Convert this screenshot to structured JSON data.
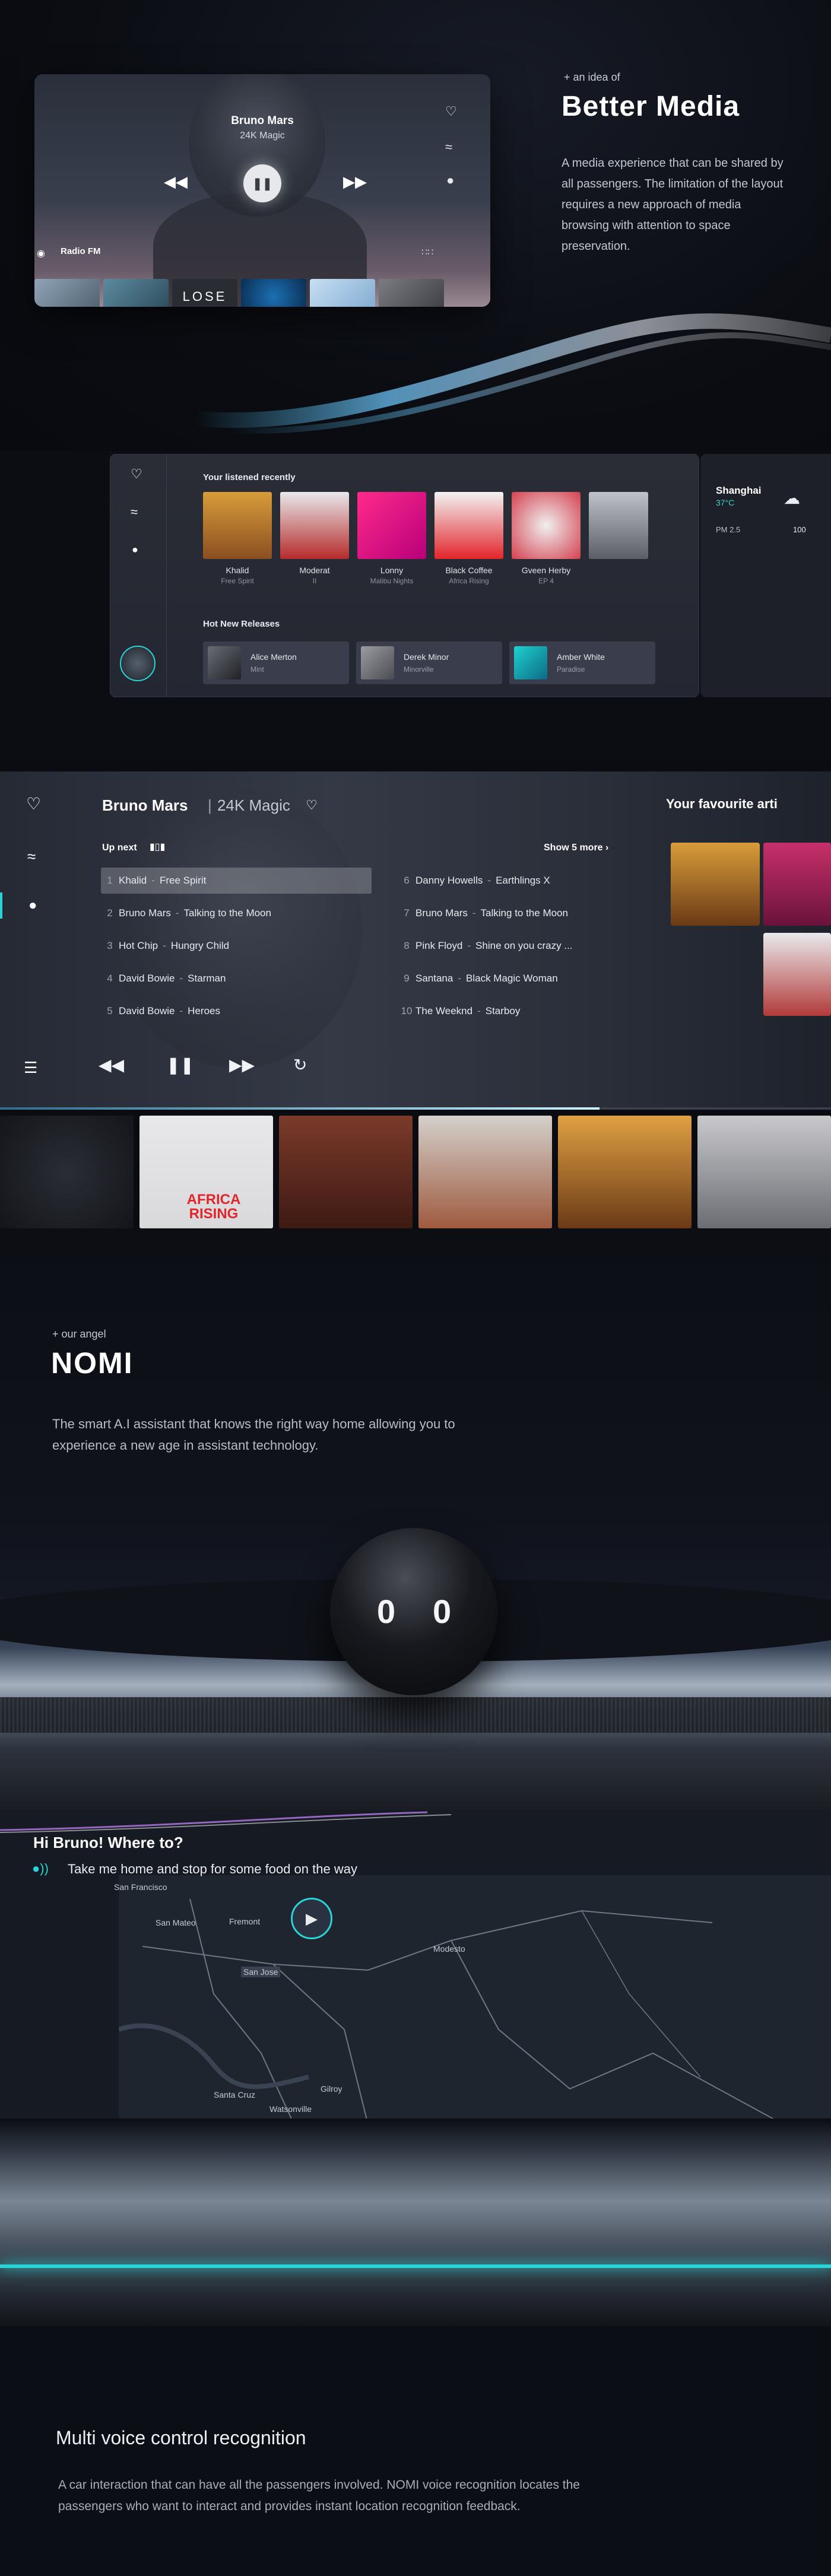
{
  "media": {
    "player": {
      "artist": "Bruno Mars",
      "album": "24K Magic",
      "radio_label": "Radio FM",
      "thumb_text": "LOSE"
    },
    "intro": {
      "kicker": "+ an idea of",
      "title": "Better Media",
      "body": "A media experience that can be shared by all passengers. The limitation of the layout requires a new approach of media browsing with attention to space preservation."
    }
  },
  "library": {
    "recent_heading": "Your listened recently",
    "recent": [
      {
        "name": "Khalid",
        "sub": "Free Spirit"
      },
      {
        "name": "Moderat",
        "sub": "II"
      },
      {
        "name": "Lonny",
        "sub": "Malibu Nights"
      },
      {
        "name": "Black Coffee",
        "sub": "Africa Rising"
      },
      {
        "name": "Gveen Herby",
        "sub": "EP 4"
      }
    ],
    "releases_heading": "Hot New Releases",
    "releases": [
      {
        "name": "Alice Merton",
        "sub": "Mint"
      },
      {
        "name": "Derek Minor",
        "sub": "Minorville"
      },
      {
        "name": "Amber White",
        "sub": "Paradise"
      }
    ],
    "weather": {
      "city": "Shanghai",
      "temp": "37°C",
      "pm_label": "PM 2.5",
      "pm_value": "100"
    }
  },
  "now_playing": {
    "artist": "Bruno Mars",
    "album": "24K Magic",
    "up_next": "Up next",
    "show_more": "Show 5 more",
    "favourite_heading": "Your favourite artists",
    "favourite_heading_visible": "Your favourite arti",
    "queue": [
      {
        "n": "1",
        "artist": "Khalid",
        "song": "Free Spirit"
      },
      {
        "n": "2",
        "artist": "Bruno Mars",
        "song": "Talking to the Moon"
      },
      {
        "n": "3",
        "artist": "Hot Chip",
        "song": "Hungry Child"
      },
      {
        "n": "4",
        "artist": "David Bowie",
        "song": "Starman"
      },
      {
        "n": "5",
        "artist": "David Bowie",
        "song": "Heroes"
      },
      {
        "n": "6",
        "artist": "Danny Howells",
        "song": "Earthlings X"
      },
      {
        "n": "7",
        "artist": "Bruno Mars",
        "song": "Talking to the Moon"
      },
      {
        "n": "8",
        "artist": "Pink Floyd",
        "song": "Shine on you crazy ..."
      },
      {
        "n": "9",
        "artist": "Santana",
        "song": "Black Magic Woman"
      },
      {
        "n": "10",
        "artist": "The Weeknd",
        "song": "Starboy"
      }
    ],
    "tile_text": "AFRICA RISING"
  },
  "nomi": {
    "kicker": "+ our angel",
    "title": "NOMI",
    "body": "The smart A.I assistant that knows the right way home allowing you to experience a new age in assistant technology.",
    "eye_left": "0",
    "eye_right": "0"
  },
  "voice": {
    "greeting": "Hi Bruno! Where to?",
    "command": "Take me home and stop for some food on the way",
    "cities": [
      "San Francisco",
      "San Mateo",
      "Fremont",
      "San Jose",
      "Santa Cruz",
      "Watsonville",
      "Gilroy",
      "Modesto"
    ],
    "title": "Multi voice control recognition",
    "body": "A car interaction that can have all the passengers involved. NOMI voice recognition locates the passengers who want to interact and provides instant location recognition feedback."
  },
  "colors": {
    "accent": "#29d3d6",
    "pm_value": "#3fd0c9",
    "temp": "#3fd0c9",
    "red_album": "#e2252b",
    "pink_album": "#e3306f"
  }
}
